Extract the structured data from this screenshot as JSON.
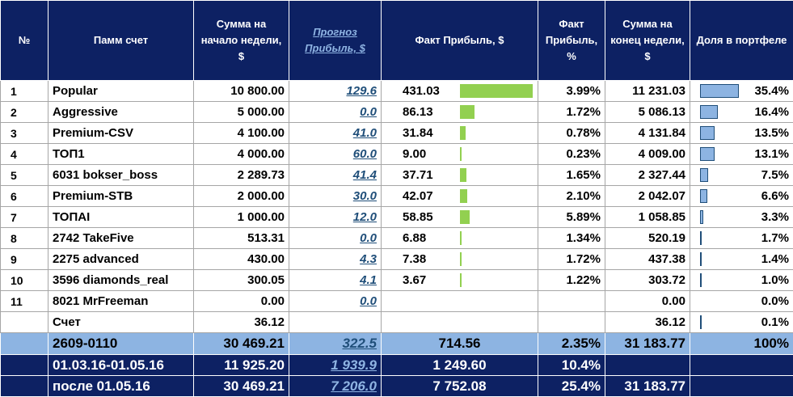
{
  "headers": {
    "num": "№",
    "account": "Памм счет",
    "start_sum": "Сумма на начало недели, $",
    "forecast": "Прогноз Прибыль, $",
    "fact_profit": "Факт Прибыль, $",
    "fact_profit_pct": "Факт Прибыль, %",
    "end_sum": "Сумма на конец недели, $",
    "share": "Доля в портфеле"
  },
  "colors": {
    "header_bg": "#0d2163",
    "profit_bar": "#92d050",
    "share_bar": "#8db4e2",
    "total_bg": "#8db4e2"
  },
  "rows": [
    {
      "num": "1",
      "account": "Popular",
      "start": "10 800.00",
      "forecast": "129.6",
      "profit": "431.03",
      "profit_value": 431.03,
      "pct": "3.99%",
      "end": "11 231.03",
      "share": "35.4%",
      "share_value": 35.4
    },
    {
      "num": "2",
      "account": "Aggressive",
      "start": "5 000.00",
      "forecast": "0.0",
      "profit": "86.13",
      "profit_value": 86.13,
      "pct": "1.72%",
      "end": "5 086.13",
      "share": "16.4%",
      "share_value": 16.4
    },
    {
      "num": "3",
      "account": "Premium-CSV",
      "start": "4 100.00",
      "forecast": "41.0",
      "profit": "31.84",
      "profit_value": 31.84,
      "pct": "0.78%",
      "end": "4 131.84",
      "share": "13.5%",
      "share_value": 13.5
    },
    {
      "num": "4",
      "account": "ТОП1",
      "start": "4 000.00",
      "forecast": "60.0",
      "profit": "9.00",
      "profit_value": 9.0,
      "pct": "0.23%",
      "end": "4 009.00",
      "share": "13.1%",
      "share_value": 13.1
    },
    {
      "num": "5",
      "account": "6031 bokser_boss",
      "start": "2 289.73",
      "forecast": "41.4",
      "profit": "37.71",
      "profit_value": 37.71,
      "pct": "1.65%",
      "end": "2 327.44",
      "share": "7.5%",
      "share_value": 7.5
    },
    {
      "num": "6",
      "account": "Premium-STB",
      "start": "2 000.00",
      "forecast": "30.0",
      "profit": "42.07",
      "profit_value": 42.07,
      "pct": "2.10%",
      "end": "2 042.07",
      "share": "6.6%",
      "share_value": 6.6
    },
    {
      "num": "7",
      "account": "ТОПAI",
      "start": "1 000.00",
      "forecast": "12.0",
      "profit": "58.85",
      "profit_value": 58.85,
      "pct": "5.89%",
      "end": "1 058.85",
      "share": "3.3%",
      "share_value": 3.3
    },
    {
      "num": "8",
      "account": "2742 TakeFive",
      "start": "513.31",
      "forecast": "0.0",
      "profit": "6.88",
      "profit_value": 6.88,
      "pct": "1.34%",
      "end": "520.19",
      "share": "1.7%",
      "share_value": 1.7
    },
    {
      "num": "9",
      "account": "2275 advanced",
      "start": "430.00",
      "forecast": "4.3",
      "profit": "7.38",
      "profit_value": 7.38,
      "pct": "1.72%",
      "end": "437.38",
      "share": "1.4%",
      "share_value": 1.4
    },
    {
      "num": "10",
      "account": "3596 diamonds_real",
      "start": "300.05",
      "forecast": "4.1",
      "profit": "3.67",
      "profit_value": 3.67,
      "pct": "1.22%",
      "end": "303.72",
      "share": "1.0%",
      "share_value": 1.0
    },
    {
      "num": "11",
      "account": "8021 MrFreeman",
      "start": "0.00",
      "forecast": "0.0",
      "profit": "",
      "profit_value": null,
      "pct": "",
      "end": "0.00",
      "share": "0.0%",
      "share_value": 0.0
    },
    {
      "num": "",
      "account": "Счет",
      "start": "36.12",
      "forecast": "",
      "profit": "",
      "profit_value": null,
      "pct": "",
      "end": "36.12",
      "share": "0.1%",
      "share_value": 0.1
    }
  ],
  "total": {
    "account": "2609-0110",
    "start": "30 469.21",
    "forecast": "322.5",
    "profit": "714.56",
    "pct": "2.35%",
    "end": "31 183.77",
    "share": "100%"
  },
  "summary": [
    {
      "account": "01.03.16-01.05.16",
      "start": "11 925.20",
      "forecast": "1 939.9",
      "profit": "1 249.60",
      "pct": "10.4%",
      "end": "",
      "share": ""
    },
    {
      "account": "после 01.05.16",
      "start": "30 469.21",
      "forecast": "7 206.0",
      "profit": "7 752.08",
      "pct": "25.4%",
      "end": "31 183.77",
      "share": ""
    }
  ]
}
